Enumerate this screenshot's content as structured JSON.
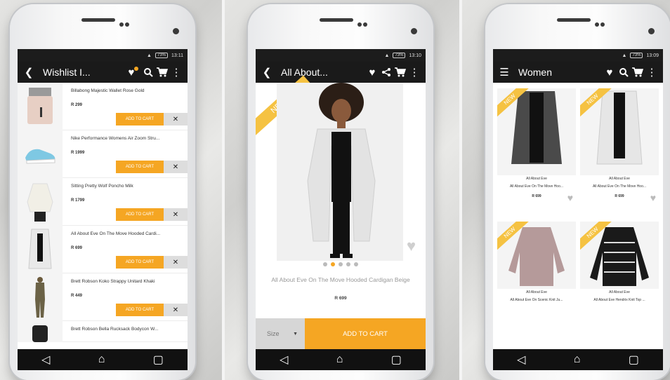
{
  "colors": {
    "accent": "#f5a623",
    "bar": "#1a1a1a"
  },
  "screen1": {
    "status": {
      "time": "13:11",
      "battery": "73%"
    },
    "title": "Wishlist I...",
    "items": [
      {
        "name": "Billabong Majestic Wallet Rose Gold",
        "price": "R 299",
        "add": "ADD TO CART",
        "remove": "✕"
      },
      {
        "name": "Nike Performance Womens Air Zoom Stru...",
        "price": "R 1999",
        "add": "ADD TO CART",
        "remove": "✕"
      },
      {
        "name": "Sitting Pretty Wolf Poncho Milk",
        "price": "R 1799",
        "add": "ADD TO CART",
        "remove": "✕"
      },
      {
        "name": "All About Eve On The Move Hooded Cardi...",
        "price": "R 699",
        "add": "ADD TO CART",
        "remove": "✕"
      },
      {
        "name": "Brett Robson Koko Strappy Unitard Khaki",
        "price": "R 449",
        "add": "ADD TO CART",
        "remove": "✕"
      }
    ],
    "partial_name": "Brett Robson Bella Rucksack Bodycon W..."
  },
  "screen2": {
    "status": {
      "time": "13:10",
      "battery": "73%"
    },
    "title": "All About...",
    "ribbon": "NEW",
    "product_name": "All About Eve On The Move Hooded Cardigan Beige",
    "price": "R 699",
    "size_label": "Size",
    "add": "ADD TO CART"
  },
  "screen3": {
    "status": {
      "time": "13:09",
      "battery": "73%"
    },
    "title": "Women",
    "ribbon": "NEW",
    "items": [
      {
        "brand": "All About Eve",
        "name": "All About Eve On The Move Hoo...",
        "price": "R 699"
      },
      {
        "brand": "All About Eve",
        "name": "All About Eve On The Move Hoo...",
        "price": "R 699"
      },
      {
        "brand": "All About Eve",
        "name": "All About Eve On Scenic Knit Ju...",
        "price": ""
      },
      {
        "brand": "All About Eve",
        "name": "All About Eve Hendrix Knit Top ...",
        "price": ""
      }
    ]
  }
}
